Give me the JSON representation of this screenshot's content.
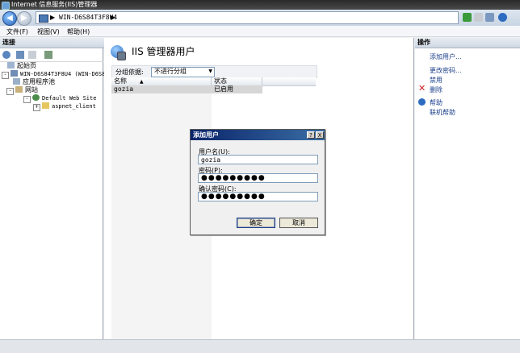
{
  "window": {
    "title": "Internet 信息服务(IIS)管理器"
  },
  "address": {
    "path": "WIN-D6S84T3F8U4",
    "sep": "▶"
  },
  "menu": {
    "file": "文件(F)",
    "view": "视图(V)",
    "help": "帮助(H)"
  },
  "left": {
    "header": "连接",
    "tree": {
      "start_page": "起始页",
      "server": "WIN-D6S84T3F8U4 (WIN-D6S84",
      "app_pools": "应用程序池",
      "sites": "网站",
      "default_site": "Default Web Site",
      "aspnet_client": "aspnet_client"
    }
  },
  "center": {
    "title": "IIS 管理器用户",
    "group_by_label": "分组依据:",
    "group_by_value": "不进行分组",
    "columns": {
      "name": "名称",
      "status": "状态"
    },
    "rows": [
      {
        "name": "gozia",
        "status": "已启用"
      }
    ]
  },
  "right": {
    "header": "操作",
    "actions": {
      "add_user": "添加用户...",
      "change_password": "更改密码...",
      "disable": "禁用",
      "delete": "删除",
      "help": "帮助",
      "online_help": "联机帮助"
    }
  },
  "dialog": {
    "title": "添加用户",
    "help_btn": "?",
    "close_btn": "X",
    "username_label": "用户名(U):",
    "username_value": "gozia",
    "password_label": "密码(P):",
    "password_value": "●●●●●●●●●",
    "confirm_label": "确认密码(C):",
    "confirm_value": "●●●●●●●●●",
    "ok": "确定",
    "cancel": "取消"
  }
}
